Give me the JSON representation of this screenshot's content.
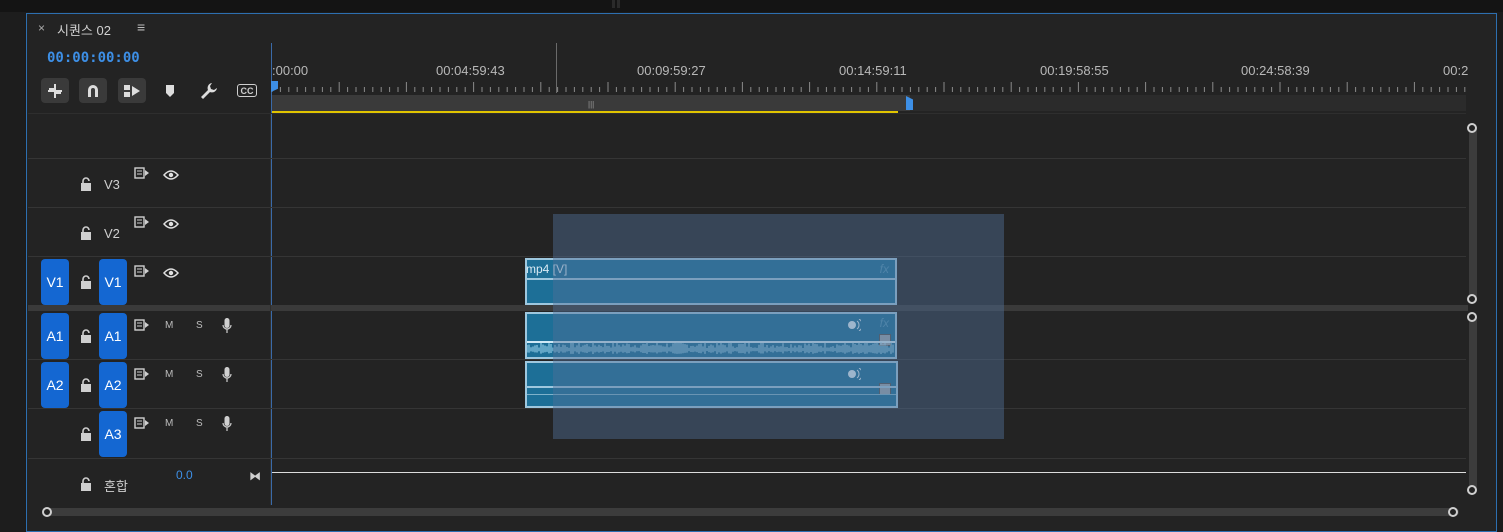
{
  "panel": {
    "tab_close": "×",
    "tab_title": "시퀀스 02",
    "tab_menu": "≡",
    "timecode": "00:00:00:00"
  },
  "toolbar": {
    "tools": [
      "nest-icon",
      "snap-magnet-icon",
      "linked-selection-icon",
      "marker-icon",
      "wrench-icon",
      "captions-icon"
    ],
    "captions_label": "CC"
  },
  "ruler": {
    "labels": [
      ":00:00",
      "00:04:59:43",
      "00:09:59:27",
      "00:14:59:11",
      "00:19:58:55",
      "00:24:58:39",
      "00:2"
    ]
  },
  "tracks": {
    "video": [
      {
        "name": "V3",
        "source": ""
      },
      {
        "name": "V2",
        "source": ""
      },
      {
        "name": "V1",
        "source": "V1"
      }
    ],
    "audio": [
      {
        "name": "A1",
        "source": "A1",
        "m": "M",
        "s": "S"
      },
      {
        "name": "A2",
        "source": "A2",
        "m": "M",
        "s": "S"
      },
      {
        "name": "A3",
        "source": "",
        "m": "M",
        "s": "S"
      }
    ],
    "mix": {
      "name": "혼합",
      "value": "0.0"
    }
  },
  "clips": {
    "video_label": "mp4 [V]",
    "fx": "fx"
  },
  "colors": {
    "accent": "#1467d2",
    "timecode": "#3d8fe6",
    "clip": "#1d6f97",
    "work_area": "#e0c400"
  }
}
